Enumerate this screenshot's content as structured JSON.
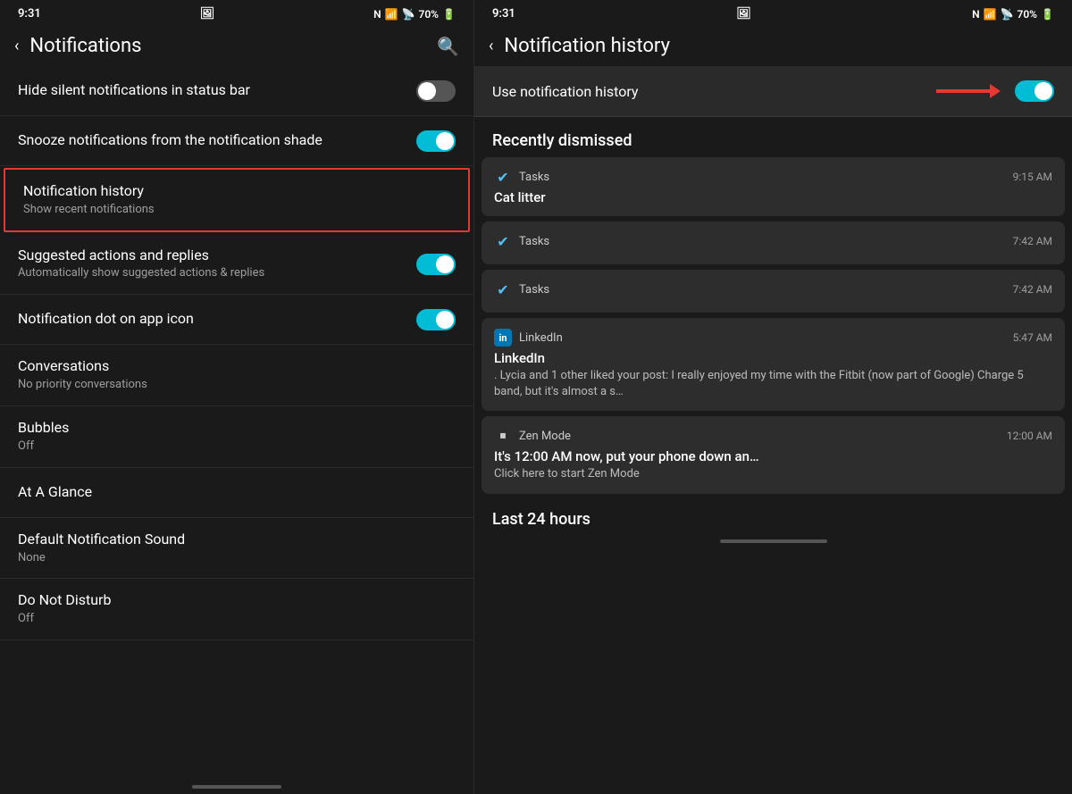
{
  "left": {
    "statusBar": {
      "time": "9:31",
      "batteryIcon": "🔋",
      "batteryPercent": "70%"
    },
    "topBar": {
      "backLabel": "‹",
      "title": "Notifications",
      "searchLabel": "🔍"
    },
    "items": [
      {
        "id": "hide-silent",
        "title": "Hide silent notifications in status bar",
        "subtitle": "",
        "toggle": true,
        "toggleOn": false,
        "highlighted": false
      },
      {
        "id": "snooze-notif",
        "title": "Snooze notifications from the notification shade",
        "subtitle": "",
        "toggle": true,
        "toggleOn": true,
        "highlighted": false
      },
      {
        "id": "notif-history",
        "title": "Notification history",
        "subtitle": "Show recent notifications",
        "toggle": false,
        "highlighted": true
      },
      {
        "id": "suggested-actions",
        "title": "Suggested actions and replies",
        "subtitle": "Automatically show suggested actions & replies",
        "toggle": true,
        "toggleOn": true,
        "highlighted": false
      },
      {
        "id": "notif-dot",
        "title": "Notification dot on app icon",
        "subtitle": "",
        "toggle": true,
        "toggleOn": true,
        "highlighted": false
      },
      {
        "id": "conversations",
        "title": "Conversations",
        "subtitle": "No priority conversations",
        "toggle": false,
        "highlighted": false
      },
      {
        "id": "bubbles",
        "title": "Bubbles",
        "subtitle": "Off",
        "toggle": false,
        "highlighted": false
      },
      {
        "id": "at-a-glance",
        "title": "At A Glance",
        "subtitle": "",
        "toggle": false,
        "highlighted": false
      },
      {
        "id": "default-sound",
        "title": "Default Notification Sound",
        "subtitle": "None",
        "toggle": false,
        "highlighted": false
      },
      {
        "id": "do-not-disturb",
        "title": "Do Not Disturb",
        "subtitle": "Off",
        "toggle": false,
        "highlighted": false
      }
    ]
  },
  "right": {
    "statusBar": {
      "time": "9:31",
      "batteryPercent": "70%"
    },
    "topBar": {
      "backLabel": "‹",
      "title": "Notification history"
    },
    "useHistoryLabel": "Use notification history",
    "toggleOn": true,
    "recentlyDismissedHeader": "Recently dismissed",
    "notifications": [
      {
        "id": "task1",
        "appName": "Tasks",
        "time": "9:15 AM",
        "title": "Cat litter",
        "body": "",
        "iconType": "tasks"
      },
      {
        "id": "task2",
        "appName": "Tasks",
        "time": "7:42 AM",
        "title": "",
        "body": "",
        "iconType": "tasks"
      },
      {
        "id": "task3",
        "appName": "Tasks",
        "time": "7:42 AM",
        "title": "",
        "body": "",
        "iconType": "tasks"
      },
      {
        "id": "linkedin1",
        "appName": "LinkedIn",
        "time": "5:47 AM",
        "title": "LinkedIn",
        "body": ". Lycia and 1 other liked your post: I really enjoyed my time with the Fitbit (now part of Google) Charge 5 band, but it's almost a s…",
        "iconType": "linkedin"
      },
      {
        "id": "zenmode1",
        "appName": "Zen Mode",
        "time": "12:00 AM",
        "title": "It's 12:00 AM now, put your phone down an…",
        "body": "Click here to start Zen Mode",
        "iconType": "zenmode"
      }
    ],
    "last24Header": "Last 24 hours"
  }
}
